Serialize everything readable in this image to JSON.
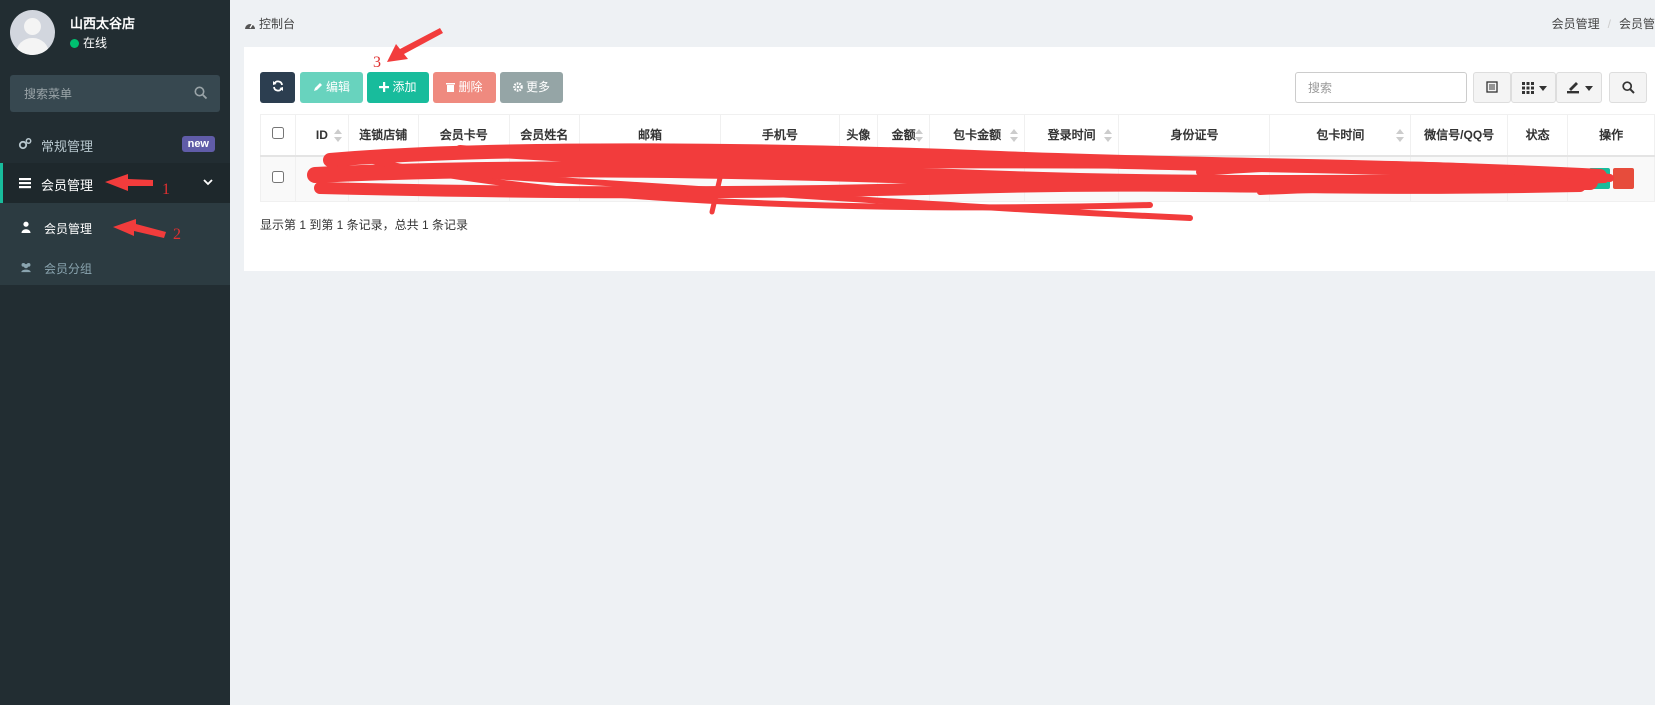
{
  "user": {
    "name": "山西太谷店",
    "status": "在线"
  },
  "sidebar": {
    "search_placeholder": "搜索菜单",
    "general": {
      "label": "常规管理",
      "badge": "new"
    },
    "members": {
      "label": "会员管理"
    },
    "submenu": [
      {
        "label": "会员管理"
      },
      {
        "label": "会员分组"
      }
    ]
  },
  "header": {
    "title": "控制台",
    "breadcrumb": [
      "会员管理",
      "会员管"
    ]
  },
  "toolbar": {
    "edit": "编辑",
    "add": "添加",
    "delete": "删除",
    "more": "更多",
    "search_placeholder": "搜索"
  },
  "table": {
    "columns": [
      "ID",
      "连锁店铺",
      "会员卡号",
      "会员姓名",
      "邮箱",
      "手机号",
      "头像",
      "金额",
      "包卡金额",
      "登录时间",
      "身份证号",
      "包卡时间",
      "微信号/QQ号",
      "状态",
      "操作"
    ]
  },
  "pagination": {
    "info": "显示第 1 到第 1 条记录，总共 1 条记录"
  },
  "annotations": {
    "one": "1",
    "two": "2",
    "three": "3"
  },
  "colors": {
    "primary": "#18bc9c",
    "sidebar": "#222d32",
    "annotation": "#e03030"
  }
}
